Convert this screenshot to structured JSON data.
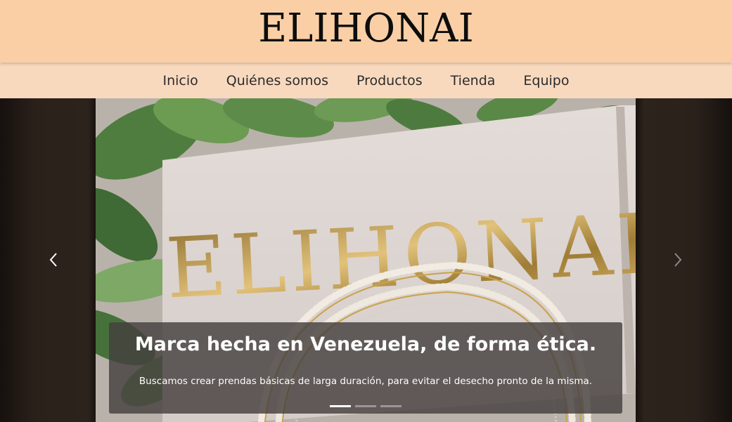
{
  "header": {
    "brand": "ELIHONAI"
  },
  "nav": {
    "items": [
      {
        "label": "Inicio"
      },
      {
        "label": "Quiénes somos"
      },
      {
        "label": "Productos"
      },
      {
        "label": "Tienda"
      },
      {
        "label": "Equipo"
      }
    ]
  },
  "carousel": {
    "image_sign_text": "ELIHONAI",
    "caption": {
      "title": "Marca hecha en Venezuela, de forma ética.",
      "text": "Buscamos crear prendas básicas de larga duración, para evitar el desecho pronto de la misma."
    },
    "active_index": 0,
    "slide_count": 3,
    "controls": {
      "prev_icon": "chevron-left-icon",
      "next_icon": "chevron-right-icon"
    }
  },
  "colors": {
    "header_bg": "#fbcfa6",
    "nav_bg": "#f9d9be",
    "caption_bg": "rgba(70,64,62,0.82)",
    "gold": "#c9a24a"
  }
}
